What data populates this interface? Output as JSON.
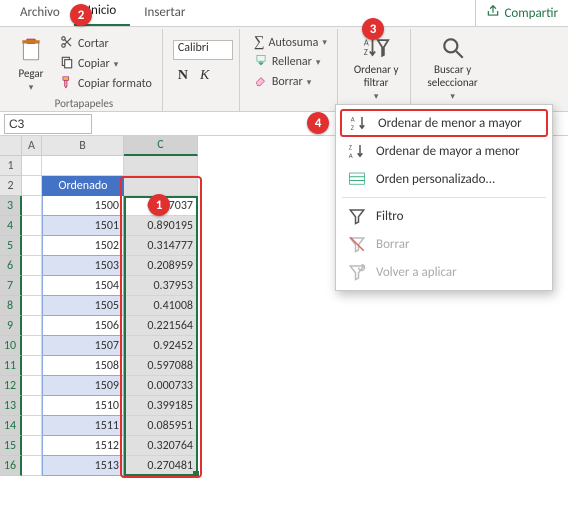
{
  "tabs": {
    "file": "Archivo",
    "home": "Inicio",
    "insert": "Insertar"
  },
  "share": "Compartir",
  "ribbon": {
    "paste": "Pegar",
    "cut": "Cortar",
    "copy": "Copiar",
    "format_painter": "Copiar formato",
    "clipboard_group": "Portapapeles",
    "font_name": "Calibri",
    "bold": "N",
    "italic": "K",
    "autosum": "Autosuma",
    "fill": "Rellenar",
    "clear": "Borrar",
    "sort_filter_top": "Ordenar y",
    "sort_filter_bottom": "filtrar",
    "find_select_top": "Buscar y",
    "find_select_bottom": "seleccionar"
  },
  "namebox": "C3",
  "columns": [
    "A",
    "B",
    "C"
  ],
  "row_numbers": [
    1,
    2,
    3,
    4,
    5,
    6,
    7,
    8,
    9,
    10,
    11,
    12,
    13,
    14,
    15,
    16
  ],
  "table_header": "Ordenado",
  "col_b": [
    "1500",
    "1501",
    "1502",
    "1503",
    "1504",
    "1505",
    "1506",
    "1507",
    "1508",
    "1509",
    "1510",
    "1511",
    "1512",
    "1513"
  ],
  "col_c": [
    "0.347037",
    "0.890195",
    "0.314777",
    "0.208959",
    "0.37953",
    "0.41008",
    "0.221564",
    "0.92452",
    "0.597088",
    "0.000733",
    "0.399185",
    "0.085951",
    "0.320764",
    "0.270481"
  ],
  "menu": {
    "asc": "Ordenar de menor a mayor",
    "desc": "Ordenar de mayor a menor",
    "custom": "Orden personalizado...",
    "filter": "Filtro",
    "clear": "Borrar",
    "reapply": "Volver a aplicar"
  },
  "callouts": {
    "c1": "1",
    "c2": "2",
    "c3": "3",
    "c4": "4"
  }
}
